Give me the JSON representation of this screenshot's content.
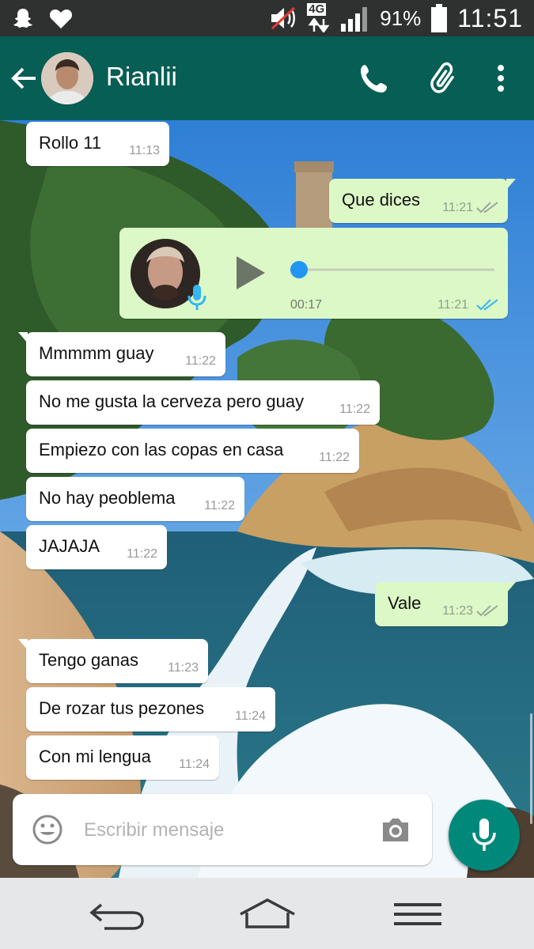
{
  "status_bar": {
    "network": "4G",
    "battery": "91%",
    "time": "11:51"
  },
  "header": {
    "contact_name": "Rianlii"
  },
  "voice_message": {
    "duration": "00:17",
    "time": "11:21",
    "progress": 0
  },
  "messages": [
    {
      "text": "Rollo 11",
      "time": "11:13",
      "direction": "in"
    },
    {
      "text": "Que dices",
      "time": "11:21",
      "direction": "out"
    },
    {
      "text": "Mmmmm guay",
      "time": "11:22",
      "direction": "in"
    },
    {
      "text": "No me gusta la cerveza pero guay",
      "time": "11:22",
      "direction": "in"
    },
    {
      "text": "Empiezo con las copas en casa",
      "time": "11:22",
      "direction": "in"
    },
    {
      "text": "No hay peoblema",
      "time": "11:22",
      "direction": "in"
    },
    {
      "text": "JAJAJA",
      "time": "11:22",
      "direction": "in"
    },
    {
      "text": "Vale",
      "time": "11:23",
      "direction": "out"
    },
    {
      "text": "Tengo ganas",
      "time": "11:23",
      "direction": "in"
    },
    {
      "text": "De rozar tus pezones",
      "time": "11:24",
      "direction": "in"
    },
    {
      "text": "Con mi lengua",
      "time": "11:24",
      "direction": "in"
    }
  ],
  "composer": {
    "placeholder": "Escribir mensaje"
  },
  "colors": {
    "header": "#075e54",
    "outgoing_bubble": "#dcf8c6",
    "incoming_bubble": "#ffffff",
    "fab": "#00897b",
    "read_ticks": "#34b7f1"
  },
  "icons": [
    "snapchat-icon",
    "heart-icon",
    "mute-icon",
    "signal-icon",
    "battery-icon",
    "back-arrow-icon",
    "phone-icon",
    "attach-icon",
    "more-icon",
    "play-icon",
    "mic-icon",
    "emoji-icon",
    "camera-icon",
    "nav-back-icon",
    "nav-home-icon",
    "nav-menu-icon"
  ]
}
